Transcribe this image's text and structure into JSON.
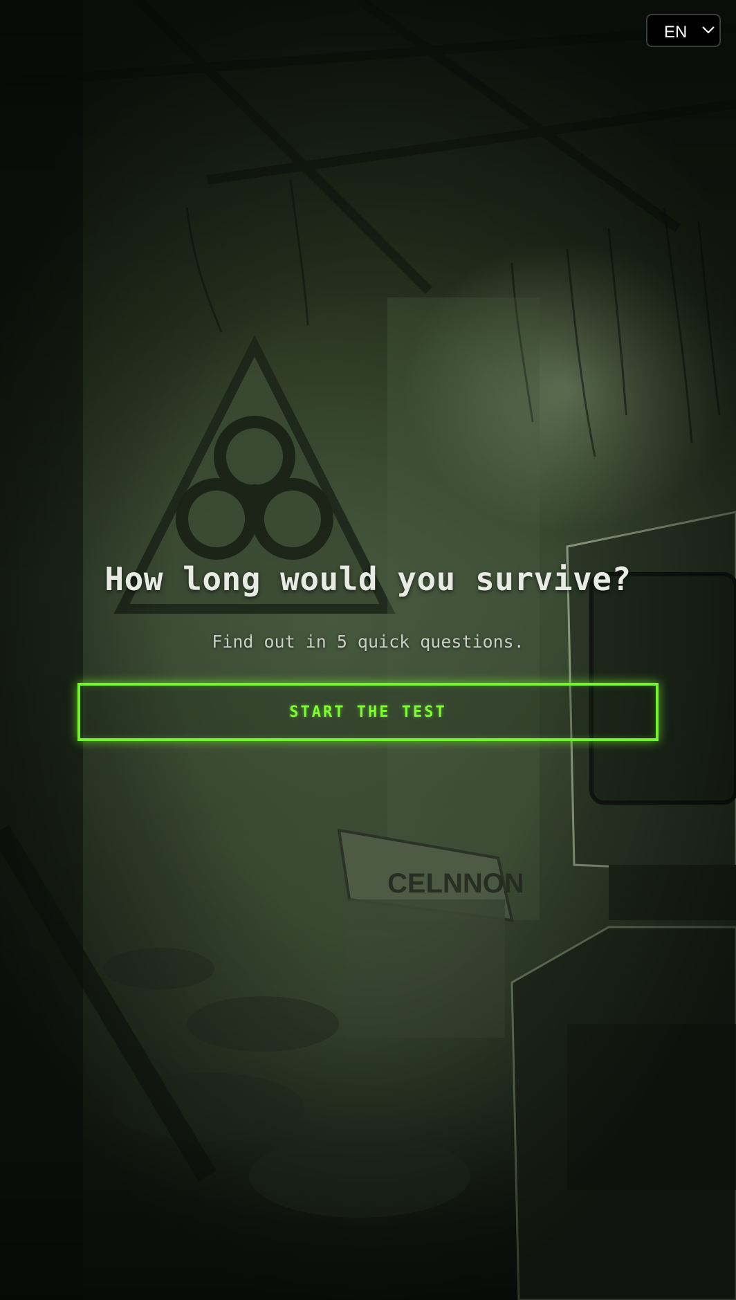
{
  "language_selector": {
    "selected": "EN",
    "icon": "chevron-down-icon"
  },
  "hero": {
    "title": "How long would you survive?",
    "subtitle": "Find out in 5 quick questions.",
    "start_label": "START THE TEST"
  },
  "background": {
    "sign_text": "CELNNON",
    "icons": [
      "biohazard-icon"
    ]
  },
  "colors": {
    "accent": "#74f52a",
    "accent_text": "#7dff2f",
    "title_text": "#e7ebe4",
    "subtitle_text": "#c9cfc5",
    "select_bg": "#000000"
  }
}
